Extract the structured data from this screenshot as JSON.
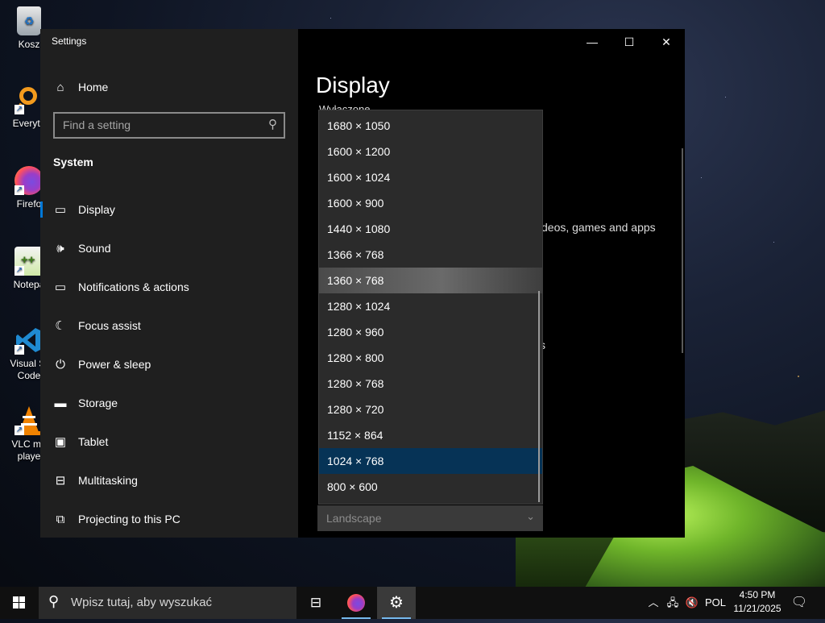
{
  "desktop": {
    "icons": [
      {
        "label": "Kosz",
        "icon": "recycle-bin-icon"
      },
      {
        "label": "Everyth",
        "icon": "everything-search-icon"
      },
      {
        "label": "Firefo",
        "icon": "firefox-icon"
      },
      {
        "label": "Notepa",
        "icon": "notepad-plus-plus-icon"
      },
      {
        "label": "Visual St\nCode",
        "icon": "vscode-icon"
      },
      {
        "label": "VLC me\nplaye",
        "icon": "vlc-icon"
      }
    ]
  },
  "settings": {
    "window_title": "Settings",
    "controls": {
      "minimize": "—",
      "maximize": "☐",
      "close": "✕"
    },
    "home_label": "Home",
    "search_placeholder": "Find a setting",
    "section_heading": "System",
    "nav_items": [
      {
        "label": "Display",
        "icon": "monitor-icon",
        "active": true
      },
      {
        "label": "Sound",
        "icon": "speaker-icon"
      },
      {
        "label": "Notifications & actions",
        "icon": "notifications-icon"
      },
      {
        "label": "Focus assist",
        "icon": "moon-icon"
      },
      {
        "label": "Power & sleep",
        "icon": "power-icon"
      },
      {
        "label": "Storage",
        "icon": "storage-icon"
      },
      {
        "label": "Tablet",
        "icon": "tablet-icon"
      },
      {
        "label": "Multitasking",
        "icon": "multitasking-icon"
      },
      {
        "label": "Projecting to this PC",
        "icon": "projecting-icon"
      }
    ],
    "content": {
      "title": "Display",
      "subtitle": "Wyłączone",
      "bg_text_1": "deos, games and apps",
      "bg_text_2": "s"
    },
    "resolution_options": [
      "1680 × 1050",
      "1600 × 1200",
      "1600 × 1024",
      "1600 × 900",
      "1440 × 1080",
      "1366 × 768",
      "1360 × 768",
      "1280 × 1024",
      "1280 × 960",
      "1280 × 800",
      "1280 × 768",
      "1280 × 720",
      "1152 × 864",
      "1024 × 768",
      "800 × 600"
    ],
    "hovered_option": "1360 × 768",
    "selected_option": "1024 × 768",
    "orientation_value": "Landscape"
  },
  "taskbar": {
    "search_placeholder": "Wpisz tutaj, aby wyszukać",
    "language": "POL",
    "time": "4:50 PM",
    "date": "11/21/2025"
  }
}
